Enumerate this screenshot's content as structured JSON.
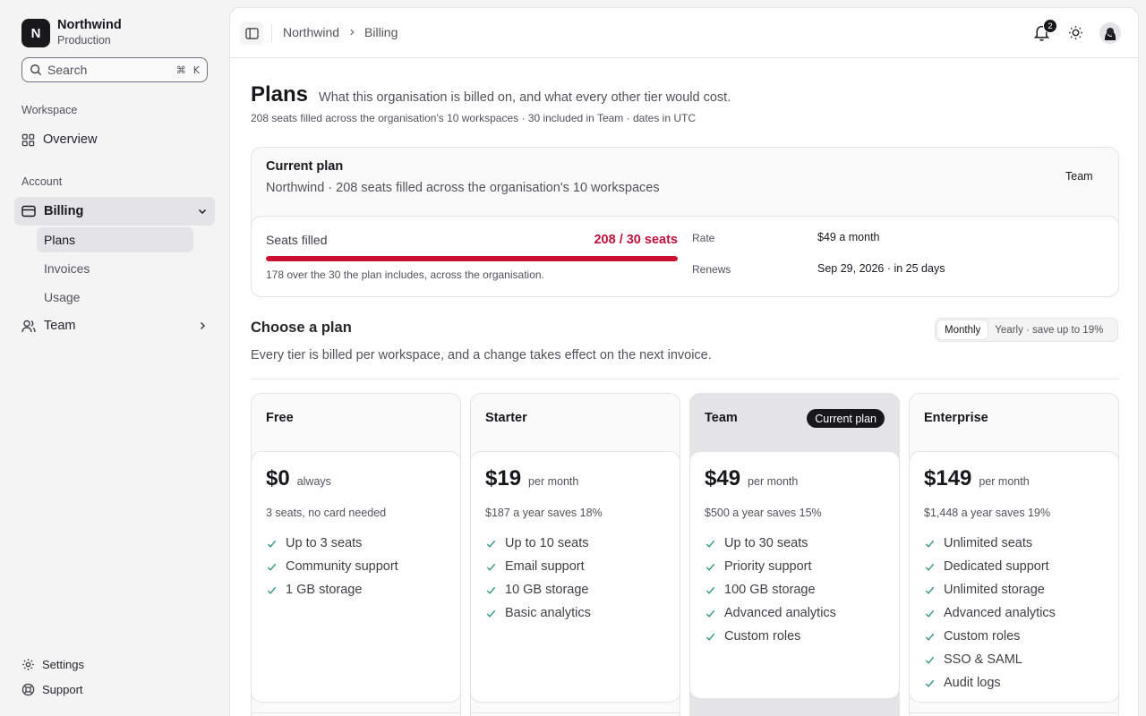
{
  "org": {
    "initial": "N",
    "name": "Northwind",
    "env": "Production"
  },
  "search": {
    "label": "Search",
    "shortcut_mod": "⌘",
    "shortcut_key": "K"
  },
  "sidebar": {
    "workspace_label": "Workspace",
    "overview": "Overview",
    "account_label": "Account",
    "billing": "Billing",
    "billing_sub": [
      "Plans",
      "Invoices",
      "Usage"
    ],
    "team": "Team",
    "settings": "Settings",
    "support": "Support"
  },
  "topbar": {
    "breadcrumb": [
      "Northwind",
      "Billing"
    ],
    "notification_count": "2"
  },
  "page": {
    "title": "Plans",
    "description": "What this organisation is billed on, and what every other tier would cost.",
    "meta": "208 seats filled across the organisation's 10 workspaces · 30 included in Team · dates in UTC"
  },
  "current_plan": {
    "title": "Current plan",
    "subtitle": "Northwind · 208 seats filled across the organisation's 10 workspaces",
    "badge": "Team",
    "seats_label": "Seats filled",
    "seats_value": "208 / 30 seats",
    "seats_fill_fraction": 1.0,
    "seats_note": "178 over the 30 the plan includes, across the organisation.",
    "rate_label": "Rate",
    "rate_value": "$49 a month",
    "renews_label": "Renews",
    "renews_value": "Sep 29, 2026 · in 25 days",
    "accent_color": "#c8102e"
  },
  "choose": {
    "title": "Choose a plan",
    "description": "Every tier is billed per workspace, and a change takes effect on the next invoice.",
    "toggle": [
      "Monthly",
      "Yearly · save up to 19%"
    ],
    "toggle_selected": "Monthly"
  },
  "plans": [
    {
      "name": "Free",
      "price": "$0",
      "period": "always",
      "note": "3 seats, no card needed",
      "features": [
        "Up to 3 seats",
        "Community support",
        "1 GB storage"
      ]
    },
    {
      "name": "Starter",
      "price": "$19",
      "period": "per month",
      "note": "$187 a year saves 18%",
      "features": [
        "Up to 10 seats",
        "Email support",
        "10 GB storage",
        "Basic analytics"
      ]
    },
    {
      "name": "Team",
      "price": "$49",
      "period": "per month",
      "note": "$500 a year saves 15%",
      "chip": "Current plan",
      "features": [
        "Up to 30 seats",
        "Priority support",
        "100 GB storage",
        "Advanced analytics",
        "Custom roles"
      ]
    },
    {
      "name": "Enterprise",
      "price": "$149",
      "period": "per month",
      "note": "$1,448 a year saves 19%",
      "features": [
        "Unlimited seats",
        "Dedicated support",
        "Unlimited storage",
        "Advanced analytics",
        "Custom roles",
        "SSO & SAML",
        "Audit logs"
      ]
    }
  ]
}
